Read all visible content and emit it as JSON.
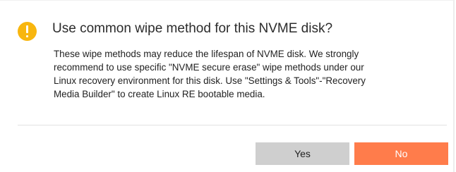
{
  "dialog": {
    "title": "Use common wipe method for this NVME disk?",
    "icon": "warning-icon",
    "message_lines": [
      "These wipe methods may reduce the lifespan of NVME disk. We strongly",
      "recommend to use specific \"NVME secure erase\" wipe methods under our",
      "Linux recovery environment for this disk. Use \"Settings & Tools\"-\"Recovery",
      "Media Builder\" to create Linux RE bootable media."
    ],
    "buttons": {
      "yes_label": "Yes",
      "no_label": "No"
    }
  },
  "colors": {
    "warning_icon": "#f8b60f",
    "yes_button": "#cfcfcf",
    "no_button": "#ff7c4b"
  }
}
